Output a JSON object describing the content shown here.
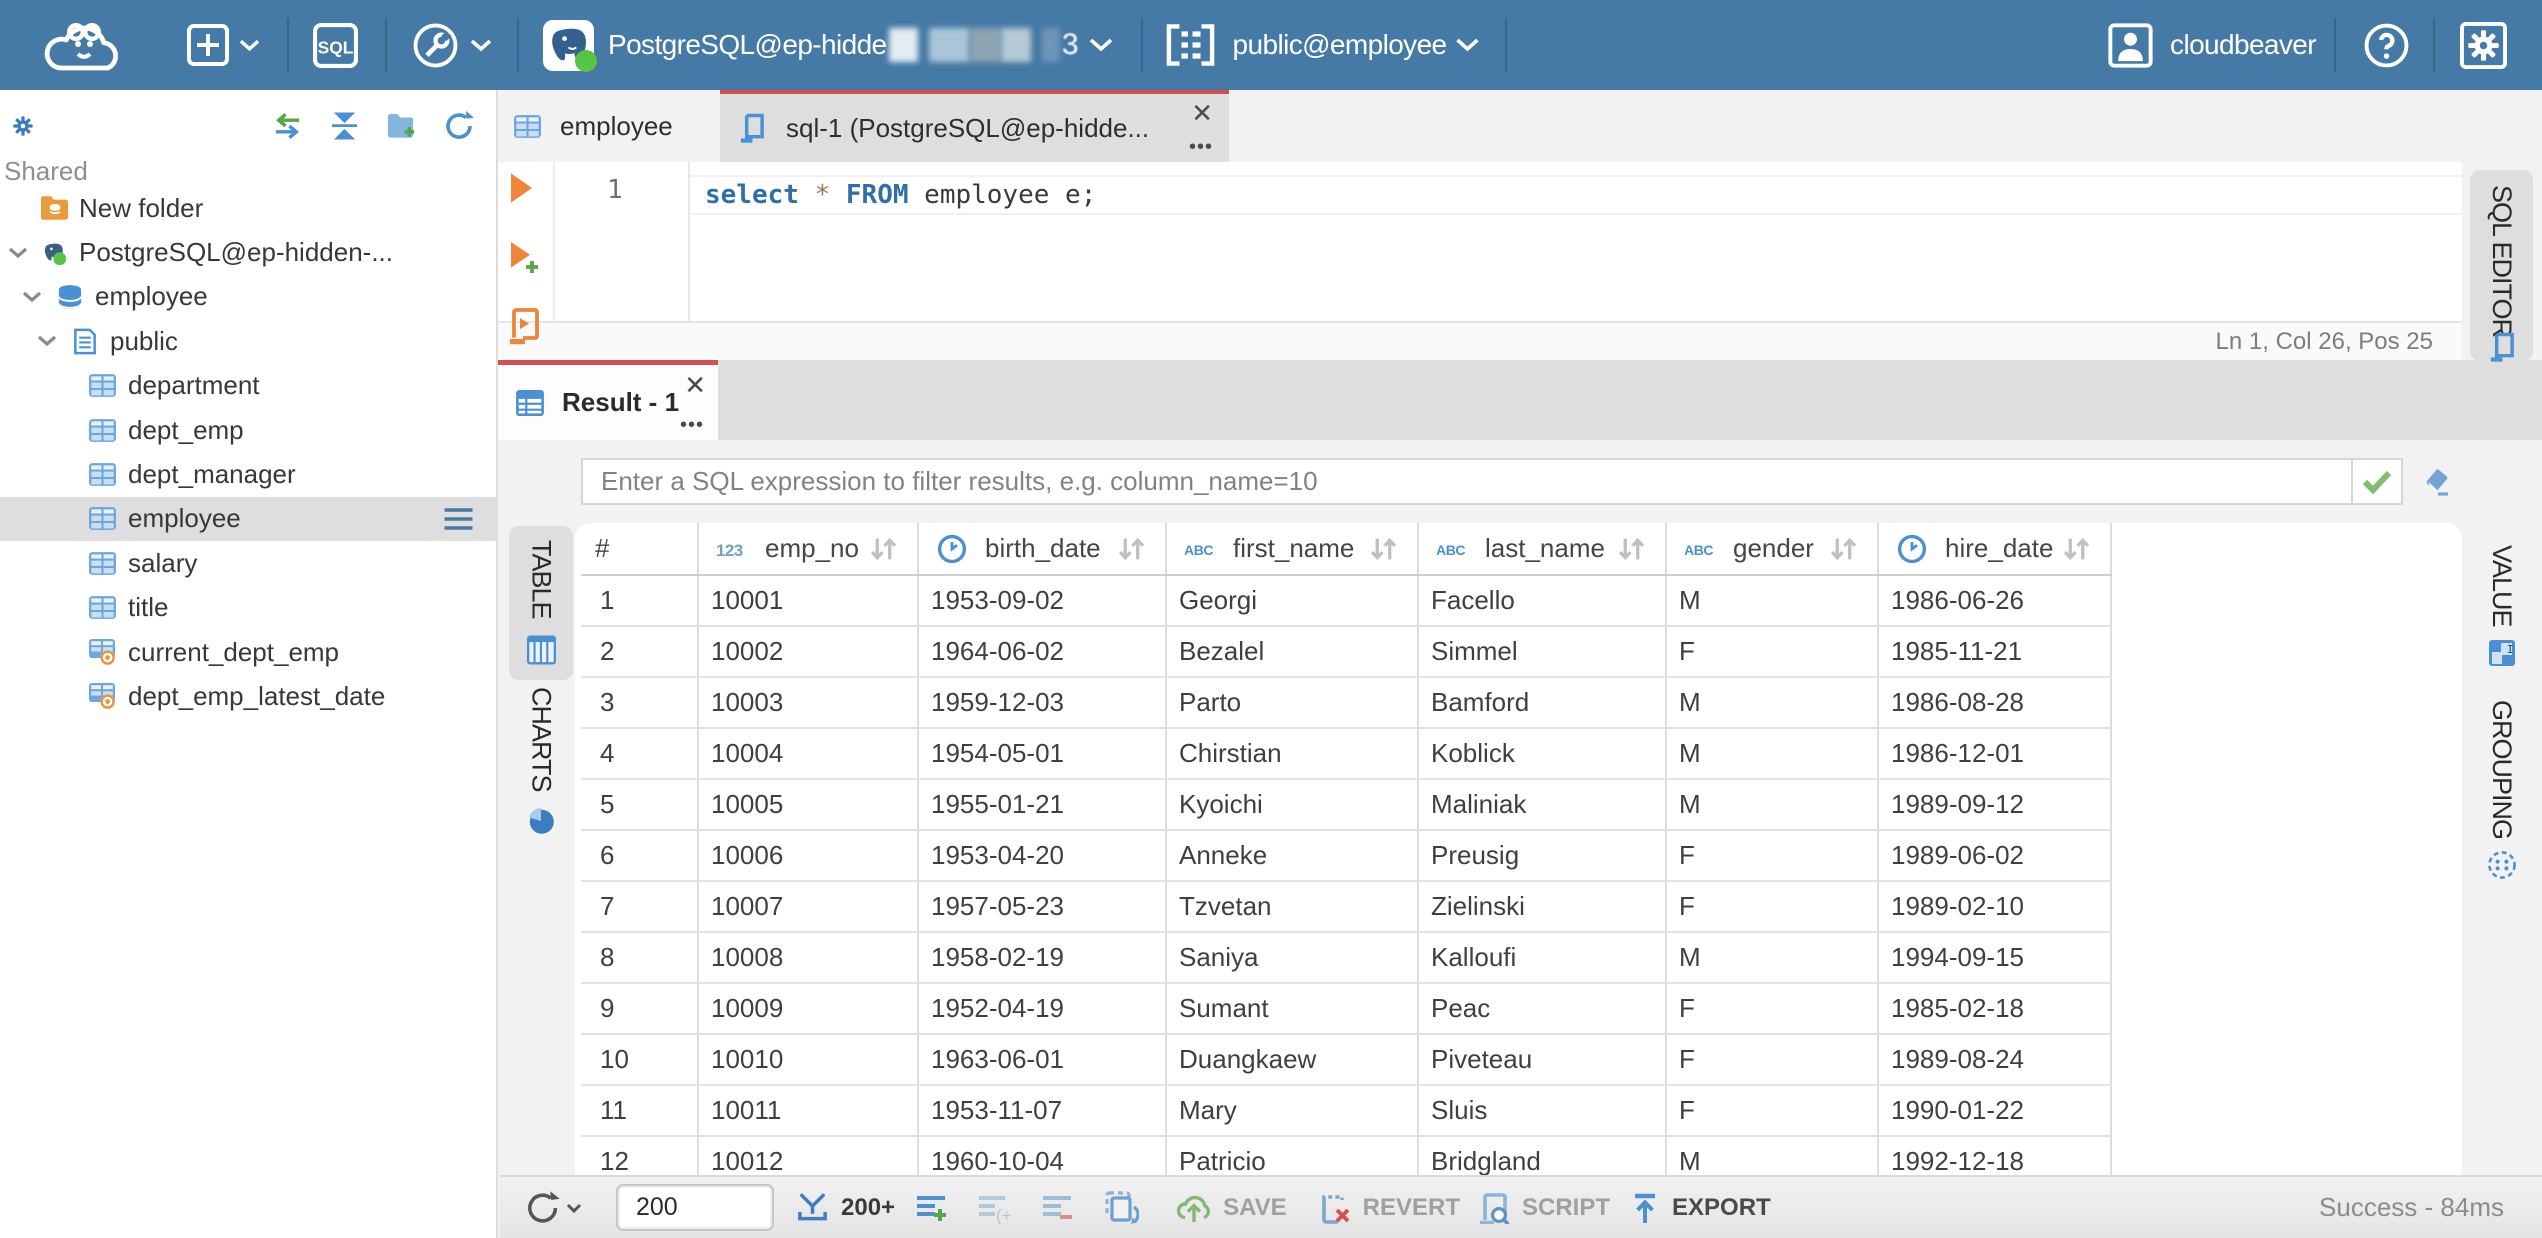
{
  "topbar": {
    "sql_label": "SQL",
    "connection": {
      "label": "PostgreSQL@ep-hidde",
      "masked_suffix": true
    },
    "schema": {
      "label": "public@employee"
    },
    "user": {
      "label": "cloudbeaver"
    }
  },
  "sidebar": {
    "group_label": "Shared",
    "tree": [
      {
        "label": "New folder",
        "icon": "folder-db",
        "level": 0,
        "chevron": "",
        "selected": false
      },
      {
        "label": "PostgreSQL@ep-hidden-...",
        "icon": "postgres",
        "level": 0,
        "chevron": "down",
        "selected": false
      },
      {
        "label": "employee",
        "icon": "database",
        "level": 1,
        "chevron": "down",
        "selected": false
      },
      {
        "label": "public",
        "icon": "schema",
        "level": 2,
        "chevron": "down",
        "selected": false
      },
      {
        "label": "department",
        "icon": "table",
        "level": 3,
        "chevron": "",
        "selected": false
      },
      {
        "label": "dept_emp",
        "icon": "table",
        "level": 3,
        "chevron": "",
        "selected": false
      },
      {
        "label": "dept_manager",
        "icon": "table",
        "level": 3,
        "chevron": "",
        "selected": false
      },
      {
        "label": "employee",
        "icon": "table",
        "level": 3,
        "chevron": "",
        "selected": true
      },
      {
        "label": "salary",
        "icon": "table",
        "level": 3,
        "chevron": "",
        "selected": false
      },
      {
        "label": "title",
        "icon": "table",
        "level": 3,
        "chevron": "",
        "selected": false
      },
      {
        "label": "current_dept_emp",
        "icon": "table-view",
        "level": 3,
        "chevron": "",
        "selected": false
      },
      {
        "label": "dept_emp_latest_date",
        "icon": "table-view",
        "level": 3,
        "chevron": "",
        "selected": false
      }
    ]
  },
  "editor_tabs": [
    {
      "label": "employee",
      "icon": "table",
      "active": false
    },
    {
      "label": "sql-1 (PostgreSQL@ep-hidde...",
      "icon": "script",
      "active": true
    }
  ],
  "editor": {
    "line_number": "1",
    "code_tokens": [
      {
        "text": "select",
        "type": "kw"
      },
      {
        "text": " ",
        "type": "plain"
      },
      {
        "text": "*",
        "type": "star"
      },
      {
        "text": " ",
        "type": "plain"
      },
      {
        "text": "FROM",
        "type": "kw"
      },
      {
        "text": " employee e;",
        "type": "plain"
      }
    ],
    "status": "Ln 1, Col 26, Pos 25"
  },
  "result": {
    "tab_label": "Result - 1",
    "filter_placeholder": "Enter a SQL expression to filter results, e.g. column_name=10"
  },
  "left_rail": [
    {
      "label": "TABLE",
      "icon": "grid-striped",
      "selected": true
    },
    {
      "label": "CHARTS",
      "icon": "pie",
      "selected": false
    }
  ],
  "right_rail": [
    {
      "label": "SQL EDITOR",
      "icon": "script",
      "selected": true
    },
    {
      "label": "VALUE",
      "icon": "value",
      "selected": false
    },
    {
      "label": "GROUPING",
      "icon": "grouping",
      "selected": false
    }
  ],
  "grid": {
    "columns": [
      {
        "name": "#",
        "type": "rownum"
      },
      {
        "name": "emp_no",
        "type": "number"
      },
      {
        "name": "birth_date",
        "type": "date"
      },
      {
        "name": "first_name",
        "type": "string"
      },
      {
        "name": "last_name",
        "type": "string"
      },
      {
        "name": "gender",
        "type": "string"
      },
      {
        "name": "hire_date",
        "type": "date"
      }
    ],
    "rows": [
      [
        "1",
        "10001",
        "1953-09-02",
        "Georgi",
        "Facello",
        "M",
        "1986-06-26"
      ],
      [
        "2",
        "10002",
        "1964-06-02",
        "Bezalel",
        "Simmel",
        "F",
        "1985-11-21"
      ],
      [
        "3",
        "10003",
        "1959-12-03",
        "Parto",
        "Bamford",
        "M",
        "1986-08-28"
      ],
      [
        "4",
        "10004",
        "1954-05-01",
        "Chirstian",
        "Koblick",
        "M",
        "1986-12-01"
      ],
      [
        "5",
        "10005",
        "1955-01-21",
        "Kyoichi",
        "Maliniak",
        "M",
        "1989-09-12"
      ],
      [
        "6",
        "10006",
        "1953-04-20",
        "Anneke",
        "Preusig",
        "F",
        "1989-06-02"
      ],
      [
        "7",
        "10007",
        "1957-05-23",
        "Tzvetan",
        "Zielinski",
        "F",
        "1989-02-10"
      ],
      [
        "8",
        "10008",
        "1958-02-19",
        "Saniya",
        "Kalloufi",
        "M",
        "1994-09-15"
      ],
      [
        "9",
        "10009",
        "1952-04-19",
        "Sumant",
        "Peac",
        "F",
        "1985-02-18"
      ],
      [
        "10",
        "10010",
        "1963-06-01",
        "Duangkaew",
        "Piveteau",
        "F",
        "1989-08-24"
      ],
      [
        "11",
        "10011",
        "1953-11-07",
        "Mary",
        "Sluis",
        "F",
        "1990-01-22"
      ],
      [
        "12",
        "10012",
        "1960-10-04",
        "Patricio",
        "Bridgland",
        "M",
        "1992-12-18"
      ]
    ]
  },
  "btoolbar": {
    "row_limit": "200",
    "fetch_label": "200+",
    "save_label": "SAVE",
    "revert_label": "REVERT",
    "script_label": "SCRIPT",
    "export_label": "EXPORT",
    "status": "Success - 84ms"
  }
}
